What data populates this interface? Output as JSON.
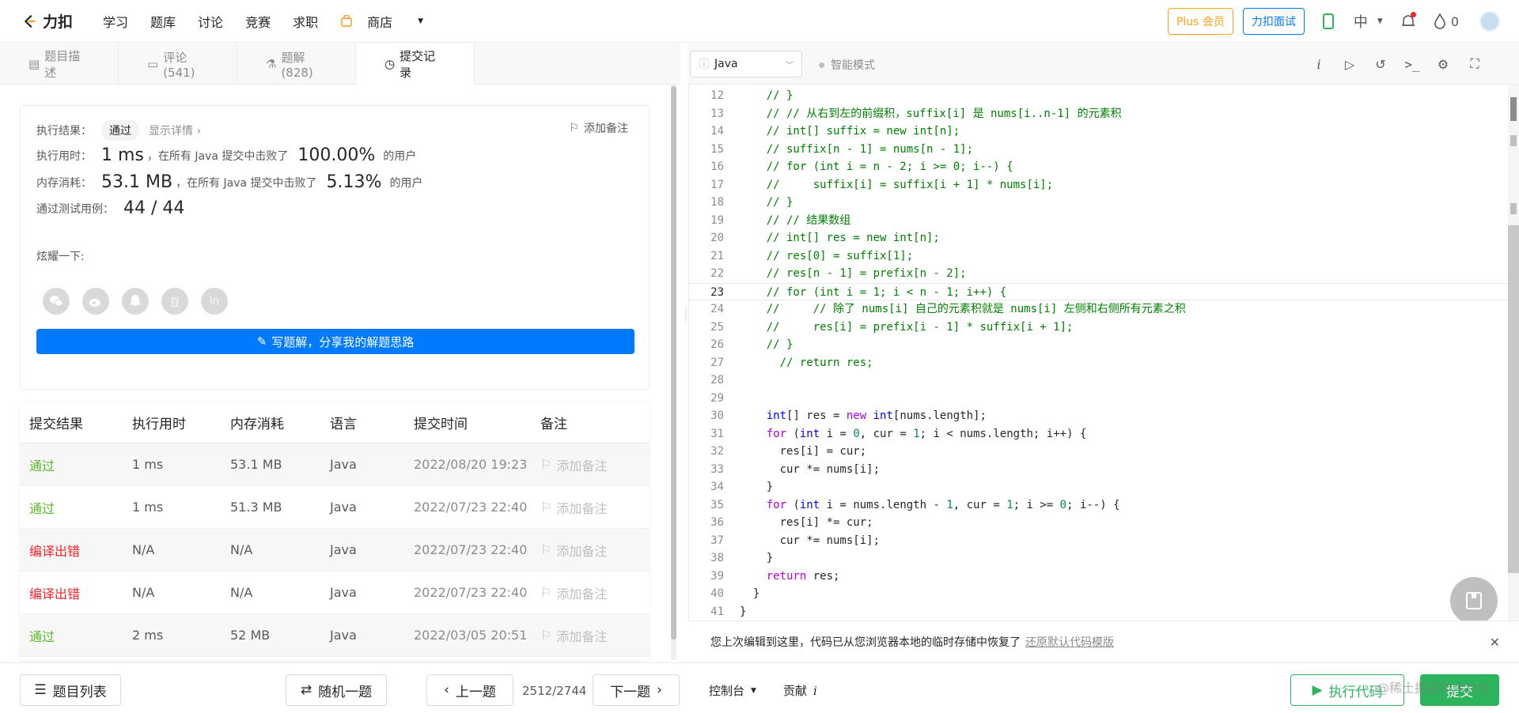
{
  "nav": {
    "logo": "力扣",
    "links": [
      "学习",
      "题库",
      "讨论",
      "竞赛",
      "求职"
    ],
    "shop": "商店",
    "plus": "Plus 会员",
    "interview": "力扣面试",
    "lang": "中",
    "streak": "0"
  },
  "tabs": [
    {
      "label": "题目描述"
    },
    {
      "label": "评论 (541)"
    },
    {
      "label": "题解 (828)"
    },
    {
      "label": "提交记录"
    }
  ],
  "result": {
    "status_label": "执行结果：",
    "status": "通过",
    "details": "显示详情 ›",
    "add_note": "添加备注",
    "time_label": "执行用时：",
    "time_value": "1 ms",
    "time_mid": "，在所有 Java 提交中击败了",
    "time_pct": "100.00%",
    "time_tail": "的用户",
    "mem_label": "内存消耗：",
    "mem_value": "53.1 MB",
    "mem_mid": "，在所有 Java 提交中击败了",
    "mem_pct": "5.13%",
    "mem_tail": "的用户",
    "cases_label": "通过测试用例：",
    "cases_value": "44 / 44",
    "share_label": "炫耀一下:",
    "share_icons": [
      "wechat-icon",
      "weibo-icon",
      "qq-icon",
      "douban-icon",
      "linkedin-icon"
    ],
    "douban_glyph": "豆",
    "linkedin_glyph": "in",
    "write_btn": "写题解，分享我的解题思路"
  },
  "table": {
    "headers": [
      "提交结果",
      "执行用时",
      "内存消耗",
      "语言",
      "提交时间",
      "备注"
    ],
    "rows": [
      {
        "result": "通过",
        "time": "1 ms",
        "mem": "53.1 MB",
        "lang": "Java",
        "date": "2022/08/20 19:23",
        "note": "添加备注",
        "ok": true
      },
      {
        "result": "通过",
        "time": "1 ms",
        "mem": "51.3 MB",
        "lang": "Java",
        "date": "2022/07/23 22:40",
        "note": "添加备注",
        "ok": true
      },
      {
        "result": "编译出错",
        "time": "N/A",
        "mem": "N/A",
        "lang": "Java",
        "date": "2022/07/23 22:40",
        "note": "添加备注",
        "ok": false
      },
      {
        "result": "编译出错",
        "time": "N/A",
        "mem": "N/A",
        "lang": "Java",
        "date": "2022/07/23 22:40",
        "note": "添加备注",
        "ok": false
      },
      {
        "result": "通过",
        "time": "2 ms",
        "mem": "52 MB",
        "lang": "Java",
        "date": "2022/03/05 20:51",
        "note": "添加备注",
        "ok": true
      }
    ]
  },
  "bottom": {
    "problem_list": "题目列表",
    "random": "随机一题",
    "prev": "上一题",
    "page": "2512/2744",
    "next": "下一题",
    "console": "控制台",
    "contribute": "贡献",
    "contribute_i": "i",
    "run": "执行代码",
    "submit": "提交",
    "watermark": "@稀土掘金技术社区"
  },
  "editor": {
    "language": "Java",
    "smart_mode": "智能模式",
    "current_line": 23,
    "lines": [
      {
        "n": 12,
        "ind": 4,
        "t": [
          [
            "cm",
            "// }"
          ]
        ]
      },
      {
        "n": 13,
        "ind": 4,
        "t": [
          [
            "cm",
            "// // 从右到左的前缀积，suffix[i] 是 nums[i..n-1] 的元素积"
          ]
        ]
      },
      {
        "n": 14,
        "ind": 4,
        "t": [
          [
            "cm",
            "// int[] suffix = new int[n];"
          ]
        ]
      },
      {
        "n": 15,
        "ind": 4,
        "t": [
          [
            "cm",
            "// suffix[n - 1] = nums[n - 1];"
          ]
        ]
      },
      {
        "n": 16,
        "ind": 4,
        "t": [
          [
            "cm",
            "// for (int i = n - 2; i >= 0; i--) {"
          ]
        ]
      },
      {
        "n": 17,
        "ind": 4,
        "t": [
          [
            "cm",
            "//     suffix[i] = suffix[i + 1] * nums[i];"
          ]
        ]
      },
      {
        "n": 18,
        "ind": 4,
        "t": [
          [
            "cm",
            "// }"
          ]
        ]
      },
      {
        "n": 19,
        "ind": 4,
        "t": [
          [
            "cm",
            "// // 结果数组"
          ]
        ]
      },
      {
        "n": 20,
        "ind": 4,
        "t": [
          [
            "cm",
            "// int[] res = new int[n];"
          ]
        ]
      },
      {
        "n": 21,
        "ind": 4,
        "t": [
          [
            "cm",
            "// res[0] = suffix[1];"
          ]
        ]
      },
      {
        "n": 22,
        "ind": 4,
        "t": [
          [
            "cm",
            "// res[n - 1] = prefix[n - 2];"
          ]
        ]
      },
      {
        "n": 23,
        "ind": 4,
        "t": [
          [
            "cm",
            "// for (int i = 1; i < n - 1; i++) {"
          ]
        ]
      },
      {
        "n": 24,
        "ind": 4,
        "t": [
          [
            "cm",
            "//     // 除了 nums[i] 自己的元素积就是 nums[i] 左侧和右侧所有元素之积"
          ]
        ]
      },
      {
        "n": 25,
        "ind": 4,
        "t": [
          [
            "cm",
            "//     res[i] = prefix[i - 1] * suffix[i + 1];"
          ]
        ]
      },
      {
        "n": 26,
        "ind": 4,
        "t": [
          [
            "cm",
            "// }"
          ]
        ]
      },
      {
        "n": 27,
        "ind": 6,
        "t": [
          [
            "cm",
            "// return res;"
          ]
        ]
      },
      {
        "n": 28,
        "ind": 0,
        "t": []
      },
      {
        "n": 29,
        "ind": 0,
        "t": []
      },
      {
        "n": 30,
        "ind": 4,
        "t": [
          [
            "ty",
            "int"
          ],
          [
            "tx",
            "[] res = "
          ],
          [
            "kw",
            "new"
          ],
          [
            "tx",
            " "
          ],
          [
            "ty",
            "int"
          ],
          [
            "tx",
            "[nums.length];"
          ]
        ]
      },
      {
        "n": 31,
        "ind": 4,
        "t": [
          [
            "kw",
            "for"
          ],
          [
            "tx",
            " ("
          ],
          [
            "ty",
            "int"
          ],
          [
            "tx",
            " i = "
          ],
          [
            "num",
            "0"
          ],
          [
            "tx",
            ", cur = "
          ],
          [
            "num",
            "1"
          ],
          [
            "tx",
            "; i < nums.length; i++) {"
          ]
        ]
      },
      {
        "n": 32,
        "ind": 6,
        "t": [
          [
            "tx",
            "res[i] = cur;"
          ]
        ]
      },
      {
        "n": 33,
        "ind": 6,
        "t": [
          [
            "tx",
            "cur *= nums[i];"
          ]
        ]
      },
      {
        "n": 34,
        "ind": 4,
        "t": [
          [
            "tx",
            "}"
          ]
        ]
      },
      {
        "n": 35,
        "ind": 4,
        "t": [
          [
            "kw",
            "for"
          ],
          [
            "tx",
            " ("
          ],
          [
            "ty",
            "int"
          ],
          [
            "tx",
            " i = nums.length - "
          ],
          [
            "num",
            "1"
          ],
          [
            "tx",
            ", cur = "
          ],
          [
            "num",
            "1"
          ],
          [
            "tx",
            "; i >= "
          ],
          [
            "num",
            "0"
          ],
          [
            "tx",
            "; i--) {"
          ]
        ]
      },
      {
        "n": 36,
        "ind": 6,
        "t": [
          [
            "tx",
            "res[i] *= cur;"
          ]
        ]
      },
      {
        "n": 37,
        "ind": 6,
        "t": [
          [
            "tx",
            "cur *= nums[i];"
          ]
        ]
      },
      {
        "n": 38,
        "ind": 4,
        "t": [
          [
            "tx",
            "}"
          ]
        ]
      },
      {
        "n": 39,
        "ind": 4,
        "t": [
          [
            "kw",
            "return"
          ],
          [
            "tx",
            " res;"
          ]
        ]
      },
      {
        "n": 40,
        "ind": 2,
        "t": [
          [
            "tx",
            "}"
          ]
        ]
      },
      {
        "n": 41,
        "ind": 0,
        "t": [
          [
            "tx",
            "}"
          ]
        ]
      }
    ]
  },
  "notice": {
    "text": "您上次编辑到这里，代码已从您浏览器本地的临时存储中恢复了",
    "link": "还原默认代码模版",
    "close": "✕"
  }
}
